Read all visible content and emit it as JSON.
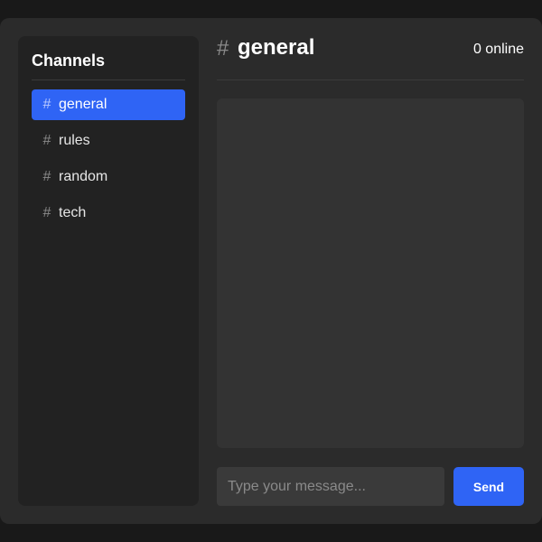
{
  "sidebar": {
    "title": "Channels",
    "items": [
      {
        "hash": "#",
        "label": "general",
        "active": true
      },
      {
        "hash": "#",
        "label": "rules",
        "active": false
      },
      {
        "hash": "#",
        "label": "random",
        "active": false
      },
      {
        "hash": "#",
        "label": "tech",
        "active": false
      }
    ]
  },
  "chat": {
    "hash": "#",
    "title": "general",
    "online": "0 online"
  },
  "composer": {
    "placeholder": "Type your message...",
    "value": "",
    "send_label": "Send"
  },
  "colors": {
    "accent": "#2f64f5",
    "background": "#191919",
    "panel": "#2b2b2b",
    "sidebar": "#222222",
    "messages_area": "#333333",
    "input": "#3a3a3a"
  },
  "icons": {
    "channel": "hash-icon"
  }
}
